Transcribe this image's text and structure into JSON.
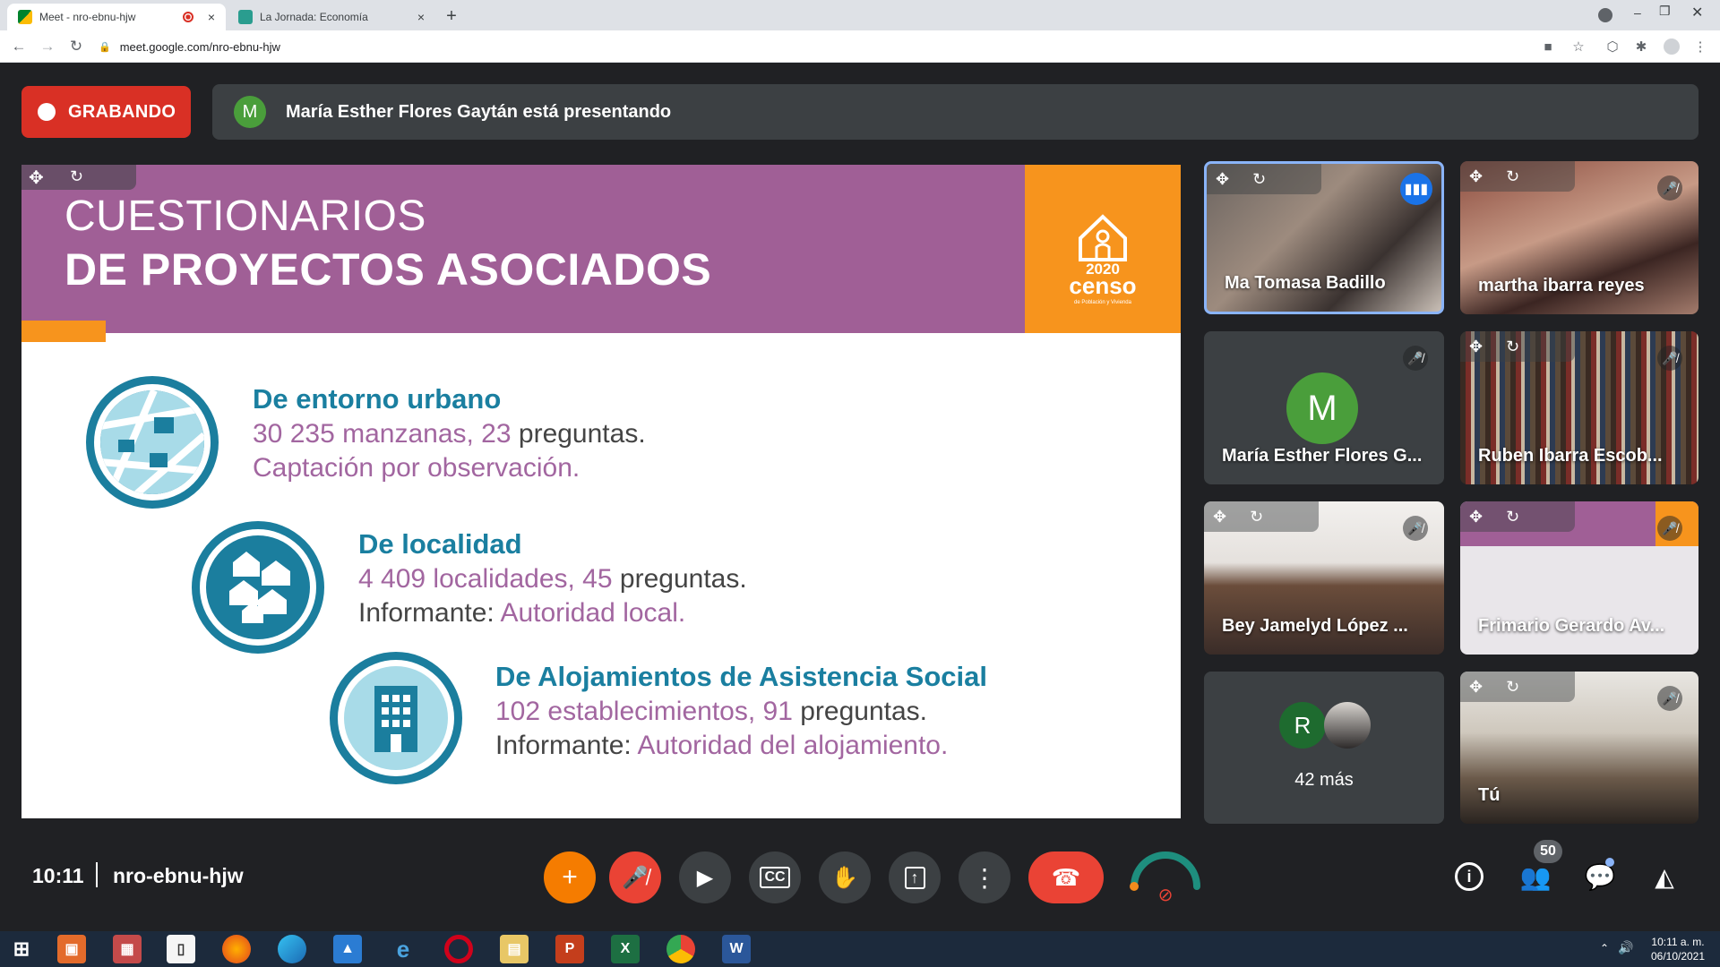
{
  "browser": {
    "tabs": [
      {
        "label": "Meet - nro-ebnu-hjw",
        "active": true,
        "recording_indicator": true
      },
      {
        "label": "La Jornada: Economía",
        "active": false
      }
    ],
    "url": "meet.google.com/nro-ebnu-hjw",
    "new_tab_symbol": "+",
    "close_symbol": "×"
  },
  "meet": {
    "recording_label": "GRABANDO",
    "presenter_initial": "M",
    "presenter_text": "María Esther Flores Gaytán está presentando"
  },
  "slide": {
    "title_line1": "CUESTIONARIOS",
    "title_line2": "DE PROYECTOS ASOCIADOS",
    "logo_year": "2020",
    "logo_word": "censo",
    "logo_sub": "de Población y Vivienda",
    "items": [
      {
        "title": "De entorno urbano",
        "count": "30 235 manzanas, 23",
        "count_suffix": "preguntas.",
        "line2_prefix": "",
        "line2": "Captación por observación."
      },
      {
        "title": "De localidad",
        "count": "4 409 localidades, 45",
        "count_suffix": "preguntas.",
        "line2_prefix": "Informante:",
        "line2": "Autoridad local."
      },
      {
        "title": "De Alojamientos de Asistencia Social",
        "count": "102 establecimientos, 91",
        "count_suffix": "preguntas.",
        "line2_prefix": "Informante:",
        "line2": "Autoridad del alojamiento."
      }
    ]
  },
  "participants": [
    {
      "name": "Ma Tomasa Badillo",
      "speaking": true
    },
    {
      "name": "martha ibarra reyes",
      "muted": true
    },
    {
      "name": "María Esther Flores G...",
      "initial": "M",
      "muted": true
    },
    {
      "name": "Ruben Ibarra Escob...",
      "muted": true
    },
    {
      "name": "Bey Jamelyd López ...",
      "muted": true
    },
    {
      "name": "Frimario Gerardo Av...",
      "muted": true
    },
    {
      "name": "42 más",
      "initial": "R"
    },
    {
      "name": "Tú",
      "muted": true
    }
  ],
  "controls": {
    "time": "10:11",
    "meeting_code": "nro-ebnu-hjw",
    "participant_count": "50"
  },
  "taskbar": {
    "time": "10:11 a. m.",
    "date": "06/10/2021"
  },
  "colors": {
    "slide_purple": "#a05f96",
    "slide_orange": "#f7941d",
    "slide_teal": "#1a7fa0",
    "record_red": "#d93025",
    "meet_dark": "#202124"
  }
}
